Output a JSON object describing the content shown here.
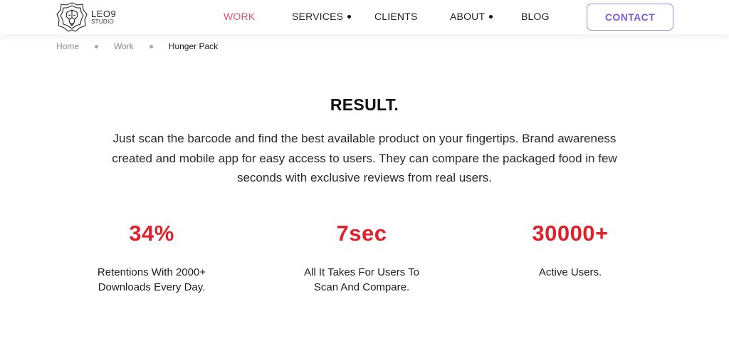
{
  "brand": {
    "name": "LEO9",
    "subtitle": "STUDIO",
    "logo_icon": "lion-head-icon"
  },
  "nav": {
    "items": [
      {
        "label": "WORK",
        "active": true,
        "has_dot": false
      },
      {
        "label": "SERVICES",
        "active": false,
        "has_dot": true
      },
      {
        "label": "CLIENTS",
        "active": false,
        "has_dot": false
      },
      {
        "label": "ABOUT",
        "active": false,
        "has_dot": true
      },
      {
        "label": "BLOG",
        "active": false,
        "has_dot": false
      }
    ],
    "contact_label": "CONTACT"
  },
  "breadcrumb": {
    "items": [
      "Home",
      "Work",
      "Hunger Pack"
    ]
  },
  "result": {
    "title": "RESULT.",
    "description": "Just scan the barcode and find the best available product on your fingertips. Brand awareness created and mobile app for easy access to users. They can compare the packaged food in few seconds with exclusive reviews from real users."
  },
  "stats": [
    {
      "value": "34%",
      "label_line1": "Retentions With 2000+",
      "label_line2": "Downloads Every Day."
    },
    {
      "value": "7sec",
      "label_line1": "All It Takes For Users To",
      "label_line2": "Scan And Compare."
    },
    {
      "value": "30000+",
      "label_line1": "Active Users.",
      "label_line2": ""
    }
  ],
  "colors": {
    "nav_active": "#e05673",
    "contact_accent": "#7e5ad6",
    "stat_value": "#e0202b"
  }
}
